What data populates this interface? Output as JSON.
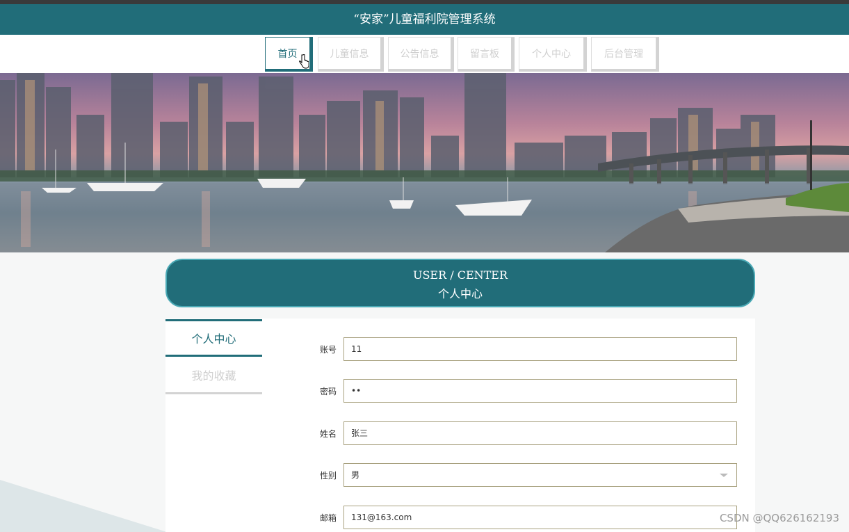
{
  "app": {
    "title": "“安家”儿童福利院管理系统"
  },
  "nav": {
    "items": [
      {
        "label": "首页"
      },
      {
        "label": "儿童信息"
      },
      {
        "label": "公告信息"
      },
      {
        "label": "留言板"
      },
      {
        "label": "个人中心"
      },
      {
        "label": "后台管理"
      }
    ],
    "active_index": 0
  },
  "section": {
    "title_en": "USER / CENTER",
    "title_zh": "个人中心"
  },
  "sidebar": {
    "items": [
      {
        "label": "个人中心"
      },
      {
        "label": "我的收藏"
      }
    ],
    "active_index": 0
  },
  "form": {
    "account": {
      "label": "账号",
      "value": "11"
    },
    "password": {
      "label": "密码",
      "value": "••"
    },
    "name": {
      "label": "姓名",
      "value": "张三"
    },
    "gender": {
      "label": "性别",
      "value": "男"
    },
    "email": {
      "label": "邮箱",
      "value": "131@163.com"
    }
  },
  "watermark": "CSDN @QQ626162193",
  "colors": {
    "primary": "#216d79",
    "inactive_text": "#cfcfcf"
  }
}
